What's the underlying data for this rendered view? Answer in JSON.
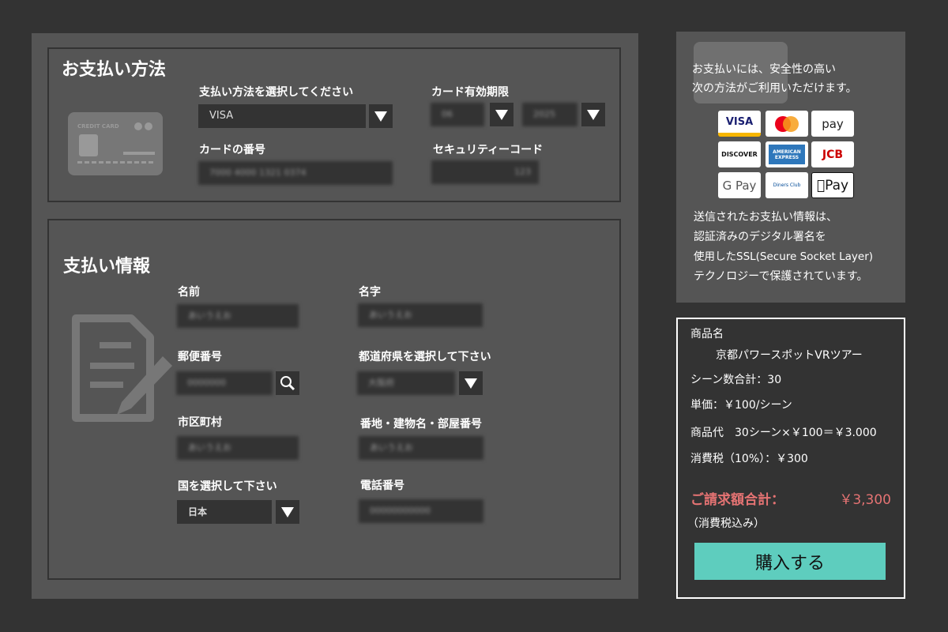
{
  "payment_method": {
    "title": "お支払い方法",
    "method_label": "支払い方法を選択してください",
    "method_value": "VISA",
    "expiry_label": "カード有効期限",
    "expiry_month": "06",
    "expiry_year": "2025",
    "card_number_label": "カードの番号",
    "card_number": "7000 4000 1321 0374",
    "security_label": "セキュリティーコード",
    "security_code": "123",
    "card_icon_text": "CREDIT CARD"
  },
  "billing": {
    "title": "支払い情報",
    "first_name_label": "名前",
    "first_name": "あいうえお",
    "last_name_label": "名字",
    "last_name": "あいうえお",
    "postal_label": "郵便番号",
    "postal": "0000000",
    "prefecture_label": "都道府県を選択して下さい",
    "prefecture": "大阪府",
    "city_label": "市区町村",
    "city": "あいうえお",
    "address_label": "番地・建物名・部屋番号",
    "address": "あいうえお",
    "country_label": "国を選択して下さい",
    "country": "日本",
    "phone_label": "電話番号",
    "phone": "00000000000"
  },
  "security_info": {
    "intro_line1": "お支払いには、安全性の高い",
    "intro_line2": "次の方法がご利用いただけます。",
    "logos": [
      "VISA",
      "Mastercard",
      "pay",
      "DISCOVER",
      "AMERICAN EXPRESS",
      "JCB",
      "G Pay",
      "Diners Club",
      "Pay"
    ],
    "note_line1": "送信されたお支払い情報は、",
    "note_line2": "認証済みのデジタル署名を",
    "note_line3": "使用したSSL(Secure Socket Layer)",
    "note_line4": "テクノロジーで保護されています。"
  },
  "summary": {
    "product_label": "商品名",
    "product_name": "京都パワースポットVRツアー",
    "scenes": "シーン数合計：30",
    "unit_price": "単価：￥100/シーン",
    "subtotal": "商品代　30シーン×￥100＝￥3.000",
    "tax": "消費税（10%）：￥300",
    "total_label": "ご請求額合計：",
    "total_value": "￥3,300",
    "tax_included": "（消費税込み）",
    "buy_label": "購入する",
    "total_color": "#e57373",
    "button_color": "#5ecdbe"
  }
}
